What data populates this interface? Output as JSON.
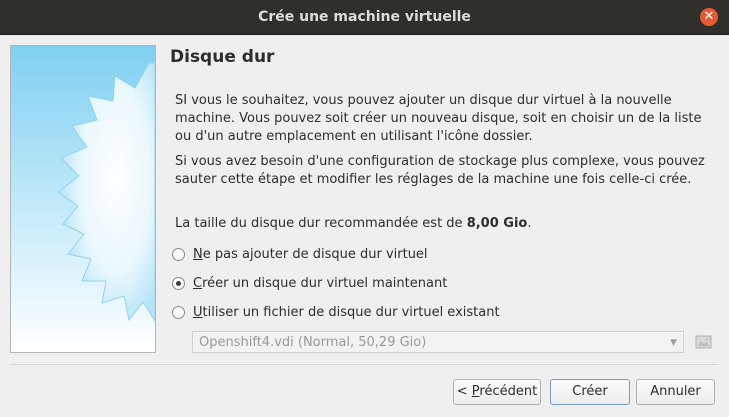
{
  "window": {
    "title": "Crée une machine virtuelle",
    "close_icon": "close-icon"
  },
  "page": {
    "heading": "Disque dur",
    "para1": "SI vous le souhaitez, vous pouvez ajouter un disque dur virtuel à la nouvelle machine. Vous pouvez soit créer un nouveau disque, soit en choisir un de la liste ou d'un autre emplacement en utilisant l'icône dossier.",
    "para2": "Si vous avez besoin d'une configuration de stockage plus complexe, vous pouvez sauter cette étape et modifier les réglages de la machine une fois celle-ci crée.",
    "para3_prefix": "La taille du disque dur recommandée est de ",
    "para3_value": "8,00 Gio",
    "para3_suffix": "."
  },
  "options": [
    {
      "mnemonic": "N",
      "rest": "e pas ajouter de disque dur virtuel",
      "checked": false
    },
    {
      "mnemonic": "C",
      "rest": "réer un disque dur virtuel maintenant",
      "checked": true
    },
    {
      "mnemonic": "U",
      "rest": "tiliser un fichier de disque dur virtuel existant",
      "checked": false
    }
  ],
  "disk_select": {
    "value": "Openshift4.vdi (Normal, 50,29 Gio)",
    "enabled": false
  },
  "buttons": {
    "prev_prefix": "< ",
    "prev_mnemonic": "P",
    "prev_rest": "récédent",
    "create": "Créer",
    "cancel": "Annuler"
  },
  "colors": {
    "titlebar": "#302f2c",
    "close": "#e35a35",
    "background": "#efefef"
  }
}
